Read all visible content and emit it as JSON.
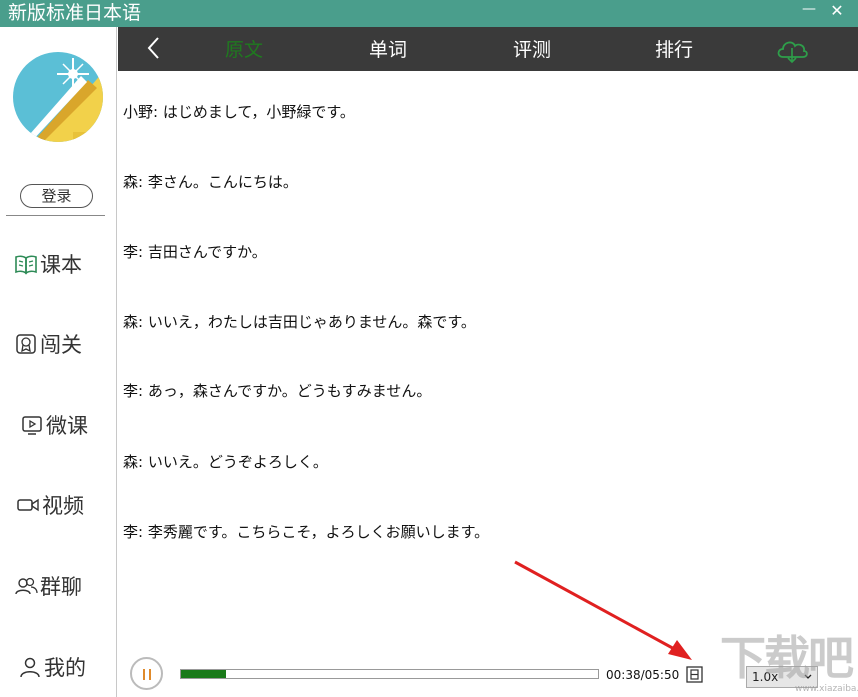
{
  "window": {
    "title": "新版标准日本语",
    "minimize_glyph": "—",
    "close_glyph": "✕"
  },
  "sidebar": {
    "login_label": "登录",
    "items": [
      {
        "label": "课本",
        "icon": "book-icon"
      },
      {
        "label": "闯关",
        "icon": "badge-icon"
      },
      {
        "label": "微课",
        "icon": "play-screen-icon"
      },
      {
        "label": "视频",
        "icon": "video-camera-icon"
      },
      {
        "label": "群聊",
        "icon": "group-icon"
      },
      {
        "label": "我的",
        "icon": "user-icon"
      }
    ]
  },
  "tabs": [
    {
      "label": "原文",
      "active": true
    },
    {
      "label": "单词",
      "active": false
    },
    {
      "label": "评测",
      "active": false
    },
    {
      "label": "排行",
      "active": false
    }
  ],
  "content": {
    "lines": [
      "小野: はじめまして，小野緑です。",
      "森: 李さん。こんにちは。",
      "李: 吉田さんですか。",
      "森: いいえ，わたしは吉田じゃありません。森です。",
      "李: あっ，森さんですか。どうもすみません。",
      "森: いいえ。どうぞよろしく。",
      "李: 李秀麗です。こちらこそ，よろしくお願いします。"
    ]
  },
  "player": {
    "time": "00:38/05:50",
    "progress": 0.109,
    "speed": "1.0x"
  },
  "colors": {
    "titlebar": "#4a9e8c",
    "tabbar": "#3a3a3a",
    "active_tab": "#1f7a1f",
    "accent_green": "#2e8b57",
    "annotation_arrow": "#e02020"
  },
  "watermark": {
    "text": "下载吧",
    "sub": "www.xiazaiba.com"
  }
}
